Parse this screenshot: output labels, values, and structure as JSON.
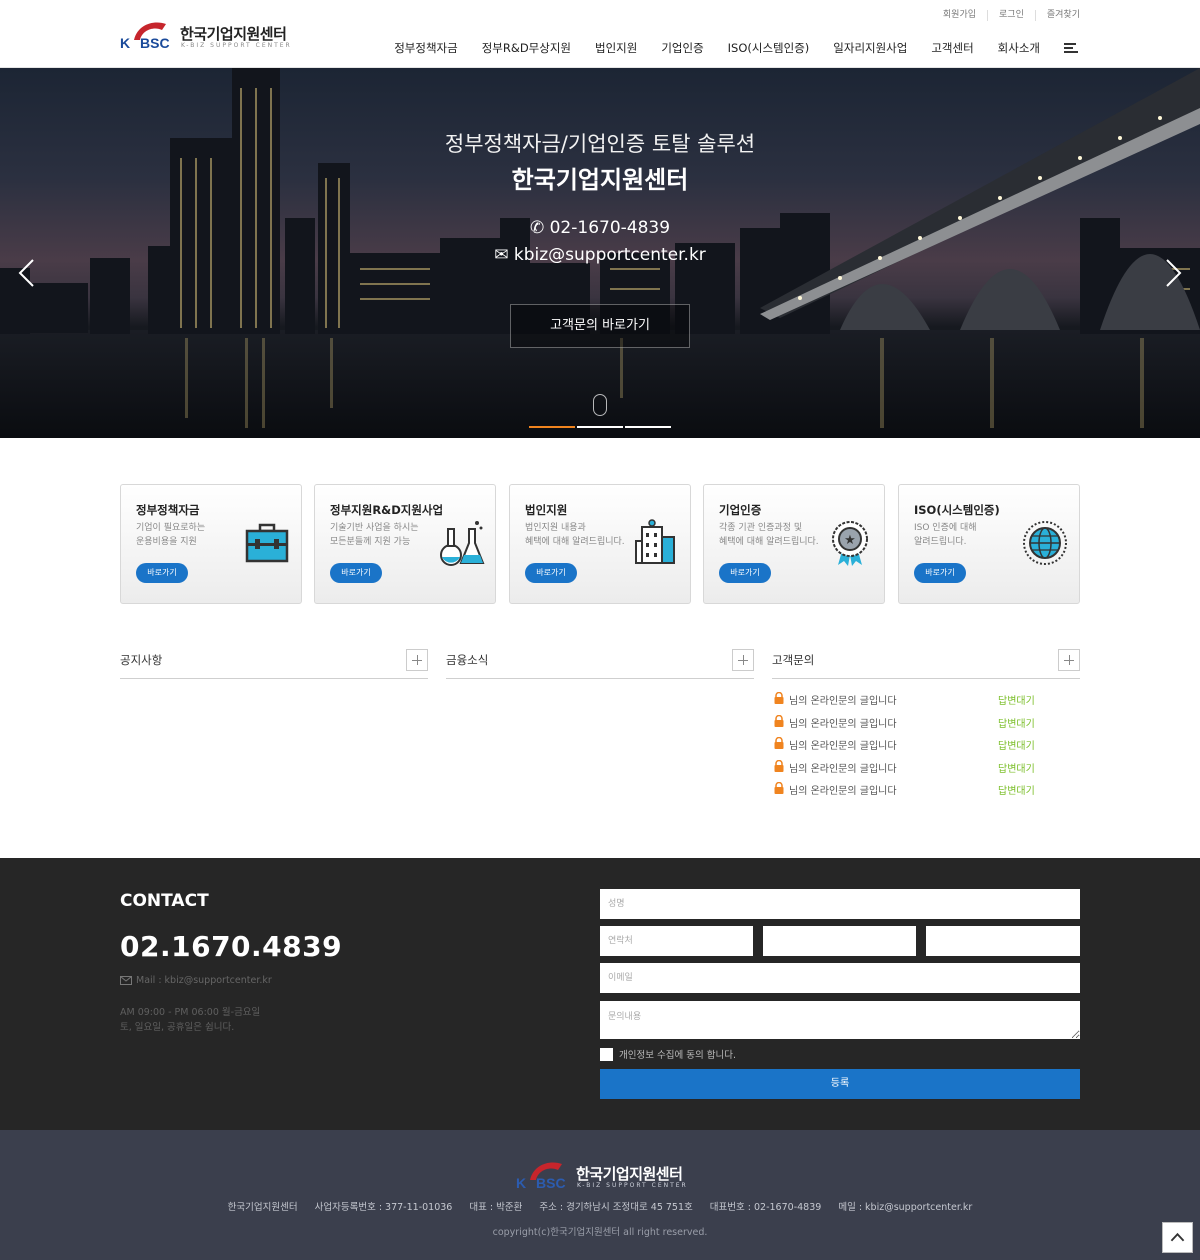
{
  "header": {
    "logo_text": "한국기업지원센터",
    "logo_sub": "K-BIZ SUPPORT CENTER",
    "logo_mark": "K·BSC",
    "util": [
      "회원가입",
      "로그인",
      "즐겨찾기"
    ],
    "nav": [
      "정부정책자금",
      "정부R&D무상지원",
      "법인지원",
      "기업인증",
      "ISO(시스템인증)",
      "일자리지원사업",
      "고객센터",
      "회사소개"
    ],
    "menu_icon": "hamburger-icon"
  },
  "hero": {
    "subtitle": "정부정책자금/기업인증 토탈 솔루션",
    "title": "한국기업지원센터",
    "phone": "02-1670-4839",
    "email": "kbiz@supportcenter.kr",
    "button": "고객문의 바로가기",
    "slides": 3,
    "active_slide": 1,
    "accent": "#f0841f"
  },
  "cards": [
    {
      "title": "정부정책자금",
      "desc1": "기업이 필요로하는",
      "desc2": "운용비용을 지원",
      "button": "바로가기",
      "icon": "briefcase-icon"
    },
    {
      "title": "정부지원R&D지원사업",
      "desc1": "기술기반 사업을 하시는",
      "desc2": "모든분들께 지원 가능",
      "button": "바로가기",
      "icon": "flask-icon"
    },
    {
      "title": "법인지원",
      "desc1": "법인지원 내용과",
      "desc2": "혜택에 대해 알려드립니다.",
      "button": "바로가기",
      "icon": "building-icon"
    },
    {
      "title": "기업인증",
      "desc1": "각종 기관 인증과정 및",
      "desc2": "혜택에 대해 알려드립니다.",
      "button": "바로가기",
      "icon": "medal-icon"
    },
    {
      "title": "ISO(시스템인증)",
      "desc1": "ISO 인증에 대해",
      "desc2": "알려드립니다.",
      "button": "바로가기",
      "icon": "globe-icon"
    }
  ],
  "boards": {
    "notice": {
      "title": "공지사항"
    },
    "finance": {
      "title": "금융소식"
    },
    "qa": {
      "title": "고객문의",
      "items": [
        {
          "text": "님의 온라인문의 글입니다",
          "status": "답변대기"
        },
        {
          "text": "님의 온라인문의 글입니다",
          "status": "답변대기"
        },
        {
          "text": "님의 온라인문의 글입니다",
          "status": "답변대기"
        },
        {
          "text": "님의 온라인문의 글입니다",
          "status": "답변대기"
        },
        {
          "text": "님의 온라인문의 글입니다",
          "status": "답변대기"
        }
      ]
    }
  },
  "contact": {
    "label": "CONTACT",
    "phone": "02.1670.4839",
    "mail": "Mail : kbiz@supportcenter.kr",
    "hours1": "AM 09:00 - PM 06:00 월-금요일",
    "hours2": "토, 일요일, 공휴일은 쉽니다.",
    "form": {
      "name_placeholder": "성명",
      "phone_placeholder": "연락처",
      "email_placeholder": "이메일",
      "message_placeholder": "문의내용",
      "agree": "개인정보 수집에 동의 합니다.",
      "submit": "등록"
    }
  },
  "footer": {
    "logo_text": "한국기업지원센터",
    "logo_sub": "K-BIZ SUPPORT CENTER",
    "info": [
      "한국기업지원센터",
      "사업자등록번호 : 377-11-01036",
      "대표 : 박준환",
      "주소 : 경기하남시 조정대로 45 751호",
      "대표번호 : 02-1670-4839",
      "메일 : kbiz@supportcenter.kr"
    ],
    "copyright": "copyright(c)한국기업지원센터 all right reserved."
  },
  "colors": {
    "primary": "#1a74c8",
    "status_waiting": "#7cbf2a",
    "lock": "#f0841f",
    "contact_bg": "#262626",
    "footer_bg": "#3b3f4d"
  }
}
